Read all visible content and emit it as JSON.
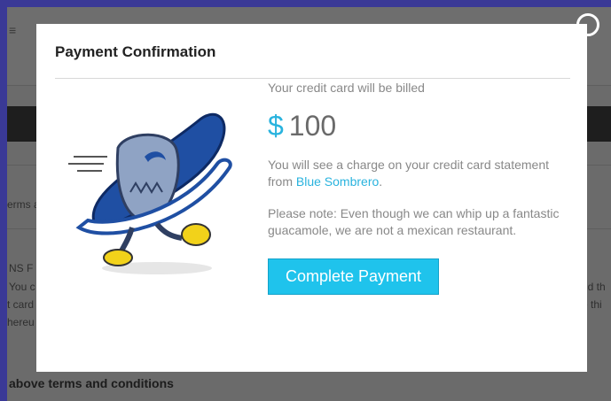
{
  "background": {
    "menu_glyph": "≡",
    "left_text_1": "erms a",
    "left_text_2": "NS F",
    "left_text_3": "You c",
    "left_text_4": "t card",
    "left_text_5": "hereu",
    "right_text_1": "nd th",
    "right_text_2": "e thi",
    "footer_text": "above terms and conditions"
  },
  "modal": {
    "title": "Payment Confirmation",
    "billed_text": "Your credit card will be billed",
    "currency": "$",
    "amount": "100",
    "charge_text": "You will see a charge on your credit card statement from ",
    "merchant_name": "Blue Sombrero",
    "charge_suffix": ".",
    "note_text": "Please note: Even though we can whip up a fantastic guacamole, we are not a mexican restaurant.",
    "button_label": "Complete Payment"
  },
  "colors": {
    "accent": "#29b3de",
    "button": "#1fc3ec",
    "overlay_border": "#3a3996"
  },
  "icons": {
    "close": "close-icon",
    "mascot": "mascot-illustration"
  }
}
